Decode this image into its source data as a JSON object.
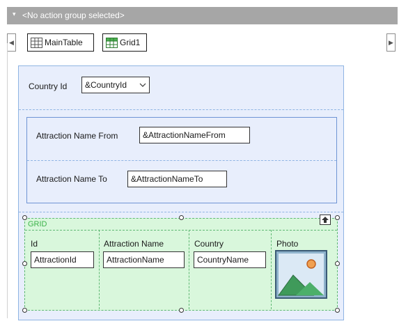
{
  "action_bar": {
    "title": "<No action group selected>"
  },
  "breadcrumb": {
    "items": [
      {
        "label": "MainTable",
        "icon": "table-icon"
      },
      {
        "label": "Grid1",
        "icon": "grid-icon"
      }
    ]
  },
  "form": {
    "country": {
      "label": "Country Id",
      "value": "&CountryId"
    },
    "attraction_from": {
      "label": "Attraction Name From",
      "value": "&AttractionNameFrom"
    },
    "attraction_to": {
      "label": "Attraction Name To",
      "value": "&AttractionNameTo"
    }
  },
  "grid": {
    "caption": "GRID",
    "columns": [
      {
        "header": "Id",
        "field": "AttractionId"
      },
      {
        "header": "Attraction Name",
        "field": "AttractionName"
      },
      {
        "header": "Country",
        "field": "CountryName"
      },
      {
        "header": "Photo",
        "image": "photo-placeholder-icon"
      }
    ]
  },
  "colors": {
    "top_bar": "#a6a6a6",
    "table_border": "#8fb4e3",
    "table_fill": "#e8eefc",
    "grid_fill": "#d9f7dc",
    "grid_border": "#5fb873",
    "grid_caption": "#3cb34a"
  }
}
